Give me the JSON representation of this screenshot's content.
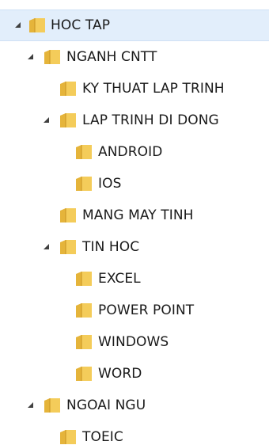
{
  "tree": {
    "items": [
      {
        "label": "HOC TAP",
        "expanded": true,
        "selected": true
      },
      {
        "label": "NGANH CNTT",
        "expanded": true
      },
      {
        "label": "KY THUAT LAP TRINH"
      },
      {
        "label": "LAP TRINH DI DONG",
        "expanded": true
      },
      {
        "label": "ANDROID"
      },
      {
        "label": "IOS"
      },
      {
        "label": "MANG MAY TINH"
      },
      {
        "label": "TIN HOC",
        "expanded": true
      },
      {
        "label": "EXCEL"
      },
      {
        "label": "POWER POINT"
      },
      {
        "label": "WINDOWS"
      },
      {
        "label": "WORD"
      },
      {
        "label": "NGOAI NGU",
        "expanded": true
      },
      {
        "label": "TOEIC"
      }
    ]
  },
  "colors": {
    "selection_background": "#e2eefb",
    "folder_front": "#f4cc5a",
    "folder_back": "#e5b43a",
    "toggle_arrow": "#404040"
  },
  "icons": {
    "expander": "triangle-down-icon",
    "folder": "folder-icon"
  }
}
